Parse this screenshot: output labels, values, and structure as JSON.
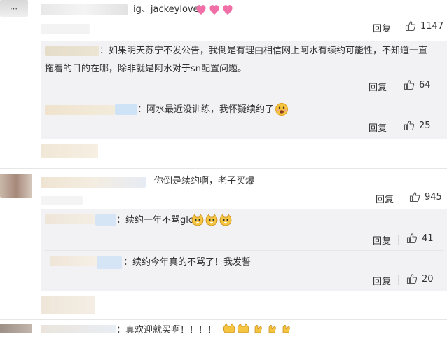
{
  "comments": [
    {
      "text": "ig、jackeylove",
      "reply_label": "回复",
      "likes": "1147",
      "replies": [
        {
          "text": "：如果明天苏宁不发公告，我倒是有理由相信网上阿水有续约可能性，不知道一直",
          "text2": "拖着的目的在哪，除非就是阿水对于sn配置问题。",
          "reply_label": "回复",
          "likes": "64"
        },
        {
          "text": "：阿水最近没训练，我怀疑续约了",
          "reply_label": "回复",
          "likes": "25"
        }
      ]
    },
    {
      "text": "你倒是续约啊，老子买爆",
      "reply_label": "回复",
      "likes": "945",
      "replies": [
        {
          "text": "：续约一年不骂glc",
          "reply_label": "回复",
          "likes": "41"
        },
        {
          "text": "：续约今年真的不骂了！我发誓",
          "reply_label": "回复",
          "likes": "20"
        }
      ]
    },
    {
      "text": "：真欢迎就买啊！！！！"
    }
  ],
  "colors": {
    "sub_bg": "#f2f2f5",
    "heart": "#f06fa6",
    "emoji_face": "#f5c542"
  }
}
